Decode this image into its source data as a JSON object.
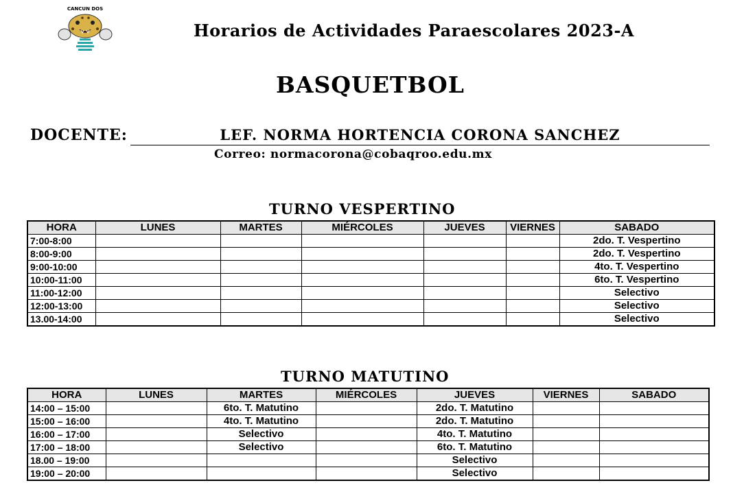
{
  "logo": {
    "text": "CANCUN DOS",
    "name": "school-jaguar-logo"
  },
  "header": {
    "title": "Horarios de Actividades Paraescolares 2023-A",
    "sport": "BASQUETBOL"
  },
  "docente": {
    "label": "DOCENTE:",
    "name": "LEF. NORMA HORTENCIA CORONA SANCHEZ",
    "correo": "Correo: normacorona@cobaqroo.edu.mx"
  },
  "vespertino": {
    "title": "TURNO VESPERTINO",
    "columns": [
      "HORA",
      "LUNES",
      "MARTES",
      "MIÉRCOLES",
      "JUEVES",
      "VIERNES",
      "SABADO"
    ],
    "rows": [
      [
        "7:00-8:00",
        "",
        "",
        "",
        "",
        "",
        "2do. T. Vespertino"
      ],
      [
        "8:00-9:00",
        "",
        "",
        "",
        "",
        "",
        "2do. T. Vespertino"
      ],
      [
        "9:00-10:00",
        "",
        "",
        "",
        "",
        "",
        "4to. T. Vespertino"
      ],
      [
        "10:00-11:00",
        "",
        "",
        "",
        "",
        "",
        "6to. T. Vespertino"
      ],
      [
        "11:00-12:00",
        "",
        "",
        "",
        "",
        "",
        "Selectivo"
      ],
      [
        "12:00-13:00",
        "",
        "",
        "",
        "",
        "",
        "Selectivo"
      ],
      [
        "13.00-14:00",
        "",
        "",
        "",
        "",
        "",
        "Selectivo"
      ]
    ]
  },
  "matutino": {
    "title": "TURNO MATUTINO",
    "columns": [
      "HORA",
      "LUNES",
      "MARTES",
      "MIÉRCOLES",
      "JUEVES",
      "VIERNES",
      "SABADO"
    ],
    "rows": [
      [
        "14:00 – 15:00",
        "",
        "6to. T. Matutino",
        "",
        "2do. T. Matutino",
        "",
        ""
      ],
      [
        "15:00 – 16:00",
        "",
        "4to. T. Matutino",
        "",
        "2do. T. Matutino",
        "",
        ""
      ],
      [
        "16:00 – 17:00",
        "",
        "Selectivo",
        "",
        "4to. T. Matutino",
        "",
        ""
      ],
      [
        "17:00 – 18:00",
        "",
        "Selectivo",
        "",
        "6to. T. Matutino",
        "",
        ""
      ],
      [
        "18.00 – 19:00",
        "",
        "",
        "",
        "Selectivo",
        "",
        ""
      ],
      [
        "19:00 – 20:00",
        "",
        "",
        "",
        "Selectivo",
        "",
        ""
      ]
    ]
  }
}
